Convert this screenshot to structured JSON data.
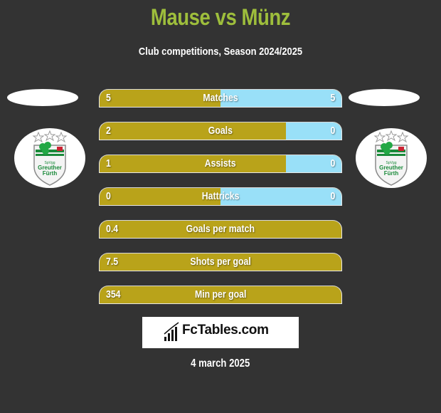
{
  "header": {
    "title": "Mause vs Münz",
    "subtitle": "Club competitions, Season 2024/2025"
  },
  "teams": {
    "left": {
      "name": "Mause",
      "club_badge": "Greuther Fürth crest"
    },
    "right": {
      "name": "Münz",
      "club_badge": "Greuther Fürth crest"
    }
  },
  "colors": {
    "title": "#9ebe3c",
    "left_bar": "#b9a31a",
    "right_bar": "#99e0f8",
    "background": "#333333"
  },
  "stats": [
    {
      "label": "Matches",
      "left": "5",
      "right": "5",
      "left_share": 0.5
    },
    {
      "label": "Goals",
      "left": "2",
      "right": "0",
      "left_share": 0.77
    },
    {
      "label": "Assists",
      "left": "1",
      "right": "0",
      "left_share": 0.77
    },
    {
      "label": "Hattricks",
      "left": "0",
      "right": "0",
      "left_share": 0.5
    },
    {
      "label": "Goals per match",
      "left": "0.4",
      "right": "",
      "left_share": 1.0
    },
    {
      "label": "Shots per goal",
      "left": "7.5",
      "right": "",
      "left_share": 1.0
    },
    {
      "label": "Min per goal",
      "left": "354",
      "right": "",
      "left_share": 1.0
    }
  ],
  "footer": {
    "brand": "FcTables.com",
    "date": "4 march 2025"
  }
}
